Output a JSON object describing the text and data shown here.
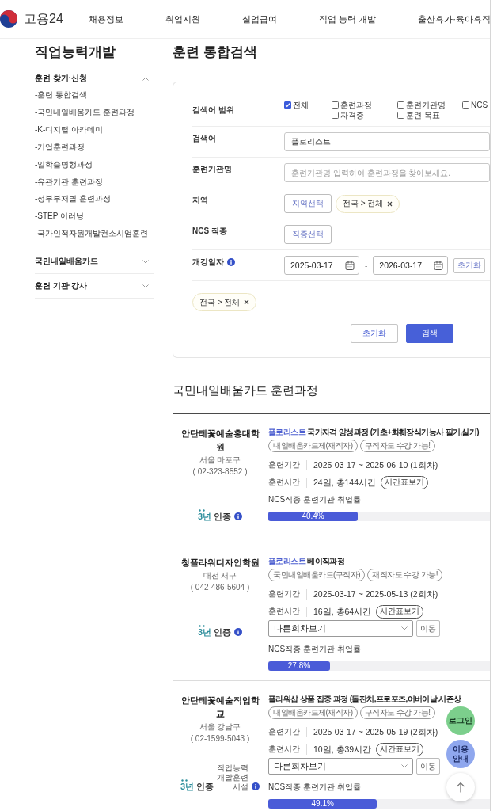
{
  "header": {
    "logo": "고용24",
    "nav": [
      "채용정보",
      "취업지원",
      "실업급여",
      "직업 능력 개발",
      "출산휴가·육아휴직"
    ]
  },
  "sidebar": {
    "title": "직업능력개발",
    "groups": [
      {
        "label": "훈련 찾기·신청",
        "expanded": true,
        "children": [
          {
            "label": "-훈련 통합검색"
          },
          {
            "label": "-국민내일배움카드 훈련과정"
          },
          {
            "label": "-K-디지털 아카데미"
          },
          {
            "label": "-기업훈련과정"
          },
          {
            "label": "-일학습병행과정"
          },
          {
            "label": "-유관기관 훈련과정"
          },
          {
            "label": "-정부부처별 훈련과정"
          },
          {
            "label": "-STEP 이러닝"
          },
          {
            "label": "-국가인적자원개발컨소시엄훈련"
          }
        ]
      },
      {
        "label": "국민내일배움카드",
        "expanded": false
      },
      {
        "label": "훈련 기관·강사",
        "expanded": false
      }
    ]
  },
  "page_title": "훈련 통합검색",
  "search_form": {
    "rows": [
      {
        "kind": "checkboxes",
        "label": "검색어 범위",
        "options": [
          {
            "label": "전체",
            "checked": true
          },
          {
            "label": "훈련과정",
            "checked": false
          },
          {
            "label": "자격증",
            "checked": false
          },
          {
            "label": "훈련기관명",
            "checked": false
          },
          {
            "label": "훈련 목표",
            "checked": false
          },
          {
            "label": "NCS",
            "checked": false
          }
        ]
      },
      {
        "kind": "text",
        "label": "검색어",
        "value": "플로리스트"
      },
      {
        "kind": "text",
        "label": "훈련기관명",
        "placeholder": "훈련기관명 입력하여 훈련과정을 찾아보세요."
      },
      {
        "kind": "picker",
        "label": "지역",
        "button": "지역선택",
        "chips": [
          "전국 > 전체"
        ]
      },
      {
        "kind": "picker",
        "label": "NCS 직종",
        "button": "직종선택"
      },
      {
        "kind": "dates",
        "label": "개강일자",
        "info": true,
        "from": "2025-03-17",
        "separator": "-",
        "to": "2026-03-17",
        "reset": "초기화"
      }
    ],
    "chips": [
      "전국 > 전체"
    ],
    "buttons": [
      {
        "kind": "reset",
        "label": "초기화"
      },
      {
        "kind": "submit",
        "label": "검색"
      }
    ]
  },
  "results": {
    "title": "국민내일배움카드 훈련과정",
    "items": [
      {
        "institution": "안단테꽃예술홍대학원",
        "location": "서울 마포구",
        "phone": "( 02-323-8552 )",
        "keyword": "플로리스트",
        "title": "국가자격 양성과정 (기초+화훼장식기능사 필기,실기)",
        "tags": [
          "내일배움카드제(재직자)",
          "구직자도 수강 가능!"
        ],
        "period_label": "훈련기간",
        "period": "2025-03-17 ~ 2025-06-10 (1회차)",
        "hours_label": "훈련시간",
        "hours": "24일, 총144시간",
        "timetable": "시간표보기",
        "rate_label": "NCS직종 훈련기관 취업률",
        "rate": "40.4%",
        "level": 0.404,
        "cert": {
          "years": "3년",
          "label": "인증"
        }
      },
      {
        "institution": "청플라워디자인학원",
        "location": "대전 서구",
        "phone": "( 042-486-5604 )",
        "keyword": "플로리스트",
        "title": "베이직과정",
        "tags": [
          "국민내일배움카드(구직자)",
          "재직자도 수강 가능!"
        ],
        "period_label": "훈련기간",
        "period": "2025-03-17 ~ 2025-05-13 (2회차)",
        "hours_label": "훈련시간",
        "hours": "16일, 총64시간",
        "timetable": "시간표보기",
        "session_select": {
          "label": "다른회차보기",
          "button": "이동"
        },
        "rate_label": "NCS직종 훈련기관 취업률",
        "rate": "27.8%",
        "level": 0.278,
        "cert": {
          "years": "3년",
          "label": "인증"
        }
      },
      {
        "institution": "안단테꽃예술직업학교",
        "location": "서울 강남구",
        "phone": "( 02-1599-5043 )",
        "title": "플라워샵 상품 집중 과정 (돌잔치,프로포즈,어버이날,시즌상",
        "tags": [
          "내일배움카드제(재직자)",
          "구직자도 수강 가능!"
        ],
        "period_label": "훈련기간",
        "period": "2025-03-17 ~ 2025-05-19 (2회차)",
        "hours_label": "훈련시간",
        "hours": "10일, 총39시간",
        "timetable": "시간표보기",
        "session_select": {
          "label": "다른회차보기",
          "button": "이동"
        },
        "rate_label": "NCS직종 훈련기관 취업률",
        "rate": "49.1%",
        "level": 0.491,
        "cert": {
          "years": "3년",
          "label": "인증",
          "facility": "직업능력 개발훈련 시설"
        }
      }
    ]
  },
  "floating_buttons": [
    {
      "kind": "login",
      "label": "로그인"
    },
    {
      "kind": "guide",
      "label": "이용 안내"
    },
    {
      "kind": "top"
    }
  ]
}
